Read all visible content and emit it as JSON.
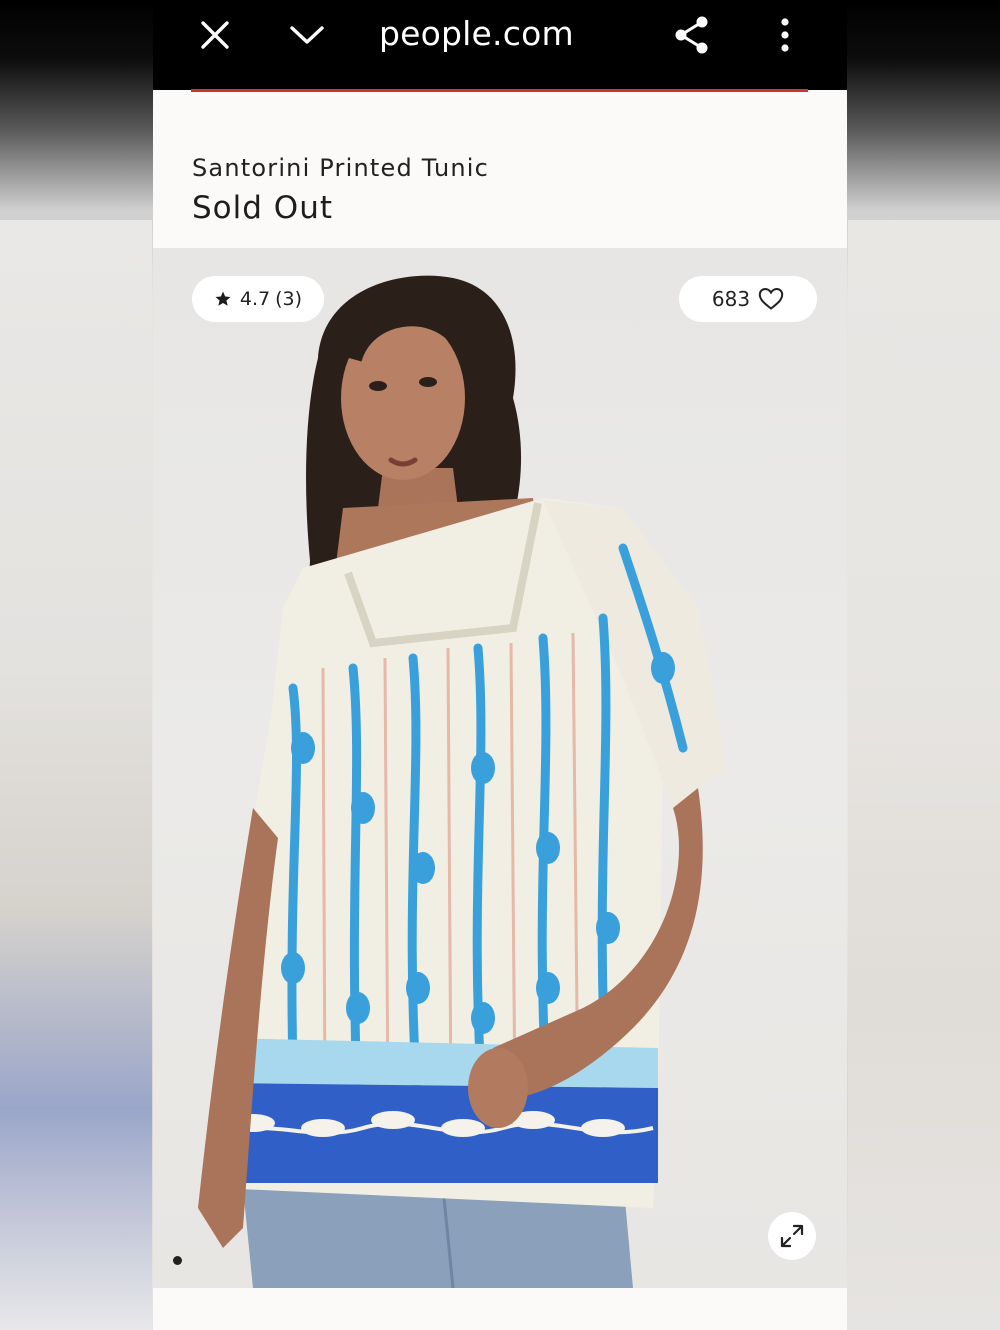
{
  "browser": {
    "url": "people.com",
    "icons": [
      "close-icon",
      "chevron-down-icon",
      "share-icon",
      "more-vert-icon"
    ]
  },
  "product": {
    "title": "Santorini Printed Tunic",
    "status": "Sold Out",
    "rating_value": "4.7",
    "rating_count": "(3)",
    "likes": "683",
    "gallery_current": 1
  },
  "colors": {
    "accent": "#c8372d",
    "topbar": "#000000",
    "tunic_blue": "#2f5fc7",
    "print_blue": "#3aa0dc"
  }
}
